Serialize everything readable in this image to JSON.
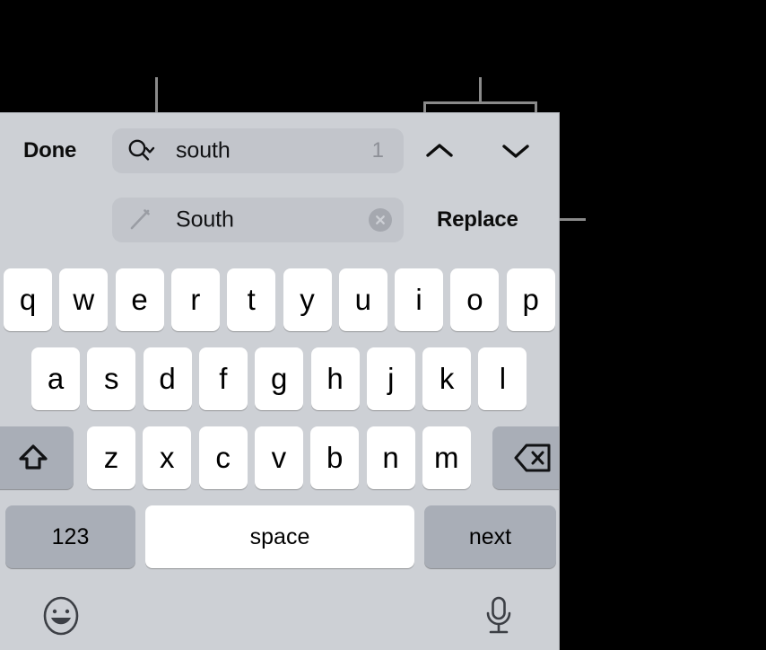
{
  "annotations": {
    "search_callout": "callout-line-to-search-options",
    "nav_callout": "callout-bracket-to-nav-arrows",
    "replace_callout": "callout-line-to-replace-button"
  },
  "findbar": {
    "done_label": "Done",
    "search": {
      "icon": "magnifier-chevron-icon",
      "value": "south",
      "placeholder": "Search",
      "match_count": "1"
    },
    "replace": {
      "icon": "pencil-icon",
      "value": "South",
      "placeholder": "Replace",
      "clear_icon": "clear-circle-x-icon"
    },
    "nav": {
      "prev_icon": "chevron-up-icon",
      "next_icon": "chevron-down-icon"
    },
    "replace_label": "Replace"
  },
  "keyboard": {
    "row1": [
      {
        "label": "q"
      },
      {
        "label": "w"
      },
      {
        "label": "e"
      },
      {
        "label": "r"
      },
      {
        "label": "t"
      },
      {
        "label": "y"
      },
      {
        "label": "u"
      },
      {
        "label": "i"
      },
      {
        "label": "o"
      },
      {
        "label": "p"
      }
    ],
    "row2": [
      {
        "label": "a"
      },
      {
        "label": "s"
      },
      {
        "label": "d"
      },
      {
        "label": "f"
      },
      {
        "label": "g"
      },
      {
        "label": "h"
      },
      {
        "label": "j"
      },
      {
        "label": "k"
      },
      {
        "label": "l"
      }
    ],
    "row3": [
      {
        "label": "z"
      },
      {
        "label": "x"
      },
      {
        "label": "c"
      },
      {
        "label": "v"
      },
      {
        "label": "b"
      },
      {
        "label": "n"
      },
      {
        "label": "m"
      }
    ],
    "shift": {
      "icon": "shift-arrow-icon"
    },
    "delete": {
      "icon": "delete-backspace-icon"
    },
    "numbers_label": "123",
    "space_label": "space",
    "next_label": "next"
  },
  "utility": {
    "emoji_icon": "emoji-smiley-icon",
    "mic_icon": "microphone-icon"
  },
  "colors": {
    "panel_bg": "#cdd0d5",
    "field_bg": "#c2c5cb",
    "key_bg": "#ffffff",
    "mod_key_bg": "#a9aeb7",
    "text": "#000000",
    "muted_text": "#8d9097",
    "callout": "#8a8a8a",
    "backdrop": "#000000"
  }
}
